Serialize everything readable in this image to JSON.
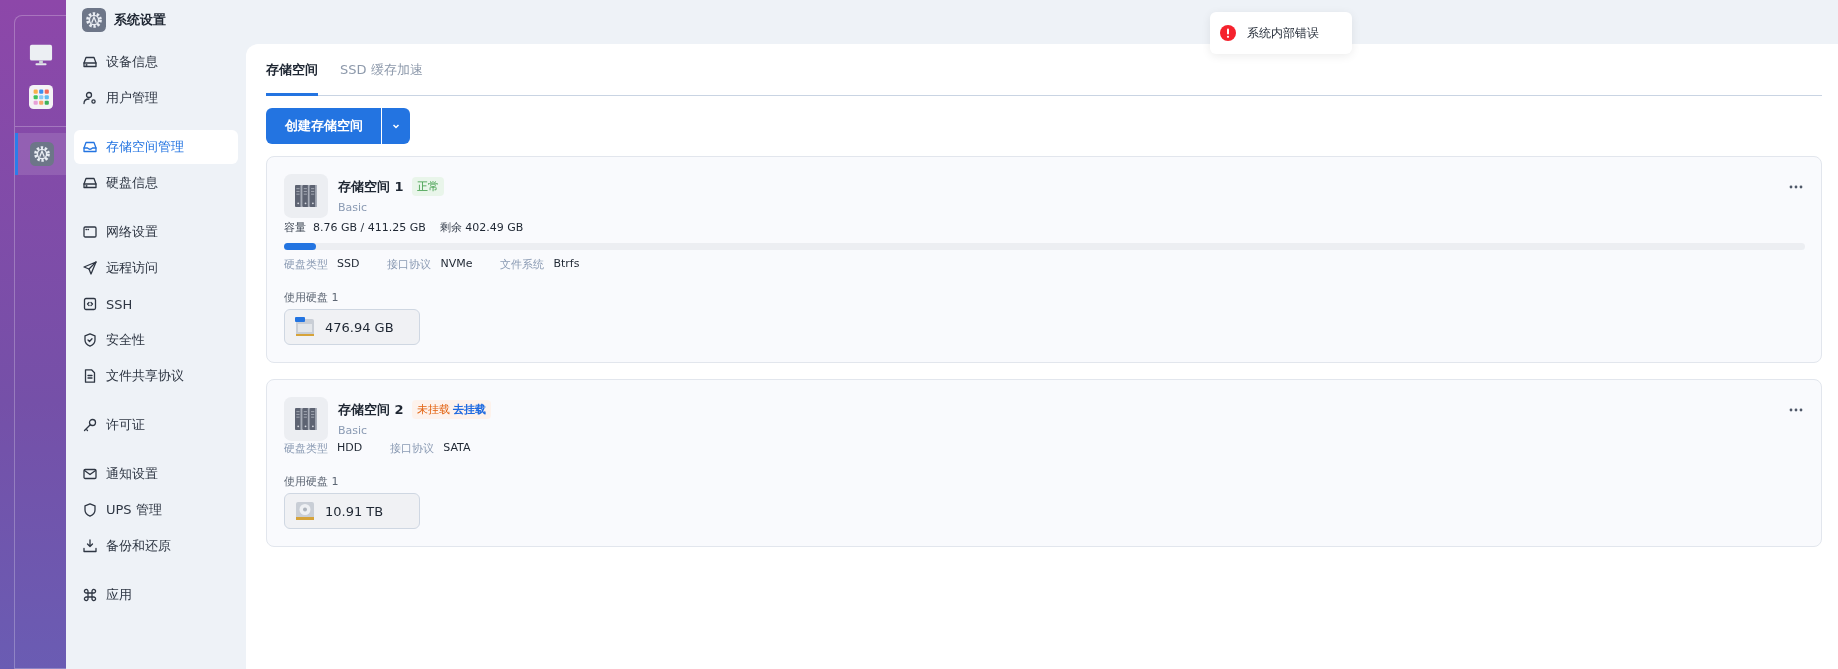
{
  "app": {
    "title": "系统设置"
  },
  "dock": [
    {
      "kind": "monitor",
      "selected": false
    },
    {
      "kind": "apps",
      "selected": false
    },
    {
      "kind": "settings",
      "selected": true
    }
  ],
  "sidebar": {
    "groups": [
      {
        "items": [
          {
            "kind": "drive",
            "label": "设备信息",
            "selected": false
          },
          {
            "kind": "user",
            "label": "用户管理",
            "selected": false
          }
        ]
      },
      {
        "items": [
          {
            "kind": "inbox",
            "label": "存储空间管理",
            "selected": true
          },
          {
            "kind": "drive",
            "label": "硬盘信息",
            "selected": false
          }
        ]
      },
      {
        "items": [
          {
            "kind": "window",
            "label": "网络设置",
            "selected": false
          },
          {
            "kind": "send",
            "label": "远程访问",
            "selected": false
          },
          {
            "kind": "code",
            "label": "SSH",
            "selected": false
          },
          {
            "kind": "shield-check",
            "label": "安全性",
            "selected": false
          },
          {
            "kind": "file",
            "label": "文件共享协议",
            "selected": false
          }
        ]
      },
      {
        "items": [
          {
            "kind": "key",
            "label": "许可证",
            "selected": false
          }
        ]
      },
      {
        "items": [
          {
            "kind": "mail",
            "label": "通知设置",
            "selected": false
          },
          {
            "kind": "shield",
            "label": "UPS 管理",
            "selected": false
          },
          {
            "kind": "download",
            "label": "备份和还原",
            "selected": false
          }
        ]
      },
      {
        "items": [
          {
            "kind": "command",
            "label": "应用",
            "selected": false
          }
        ]
      }
    ]
  },
  "toast": {
    "kind": "error",
    "message": "系统内部错误"
  },
  "tabs": [
    {
      "label": "存储空间",
      "selected": true
    },
    {
      "label": "SSD 缓存加速",
      "selected": false
    }
  ],
  "create_button": {
    "label": "创建存储空间"
  },
  "pools": [
    {
      "name": "存储空间 1",
      "status": {
        "kind": "normal",
        "label": "正常"
      },
      "type": "Basic",
      "capacity": {
        "label": "容量",
        "used": "8.76 GB / 411.25 GB",
        "free_label": "剩余",
        "free": "402.49 GB",
        "level": 0.021
      },
      "properties": [
        {
          "label": "硬盘类型",
          "value": "SSD"
        },
        {
          "label": "接口协议",
          "value": "NVMe"
        },
        {
          "label": "文件系统",
          "value": "Btrfs"
        }
      ],
      "disks_label": "使用硬盘 1",
      "disks": [
        {
          "kind": "ssd",
          "size": "476.94 GB"
        }
      ]
    },
    {
      "name": "存储空间 2",
      "status": {
        "kind": "unmounted",
        "label": "未挂载",
        "action": "去挂载"
      },
      "type": "Basic",
      "properties": [
        {
          "label": "硬盘类型",
          "value": "HDD"
        },
        {
          "label": "接口协议",
          "value": "SATA"
        }
      ],
      "disks_label": "使用硬盘 1",
      "disks": [
        {
          "kind": "hdd",
          "size": "10.91 TB"
        }
      ]
    }
  ]
}
